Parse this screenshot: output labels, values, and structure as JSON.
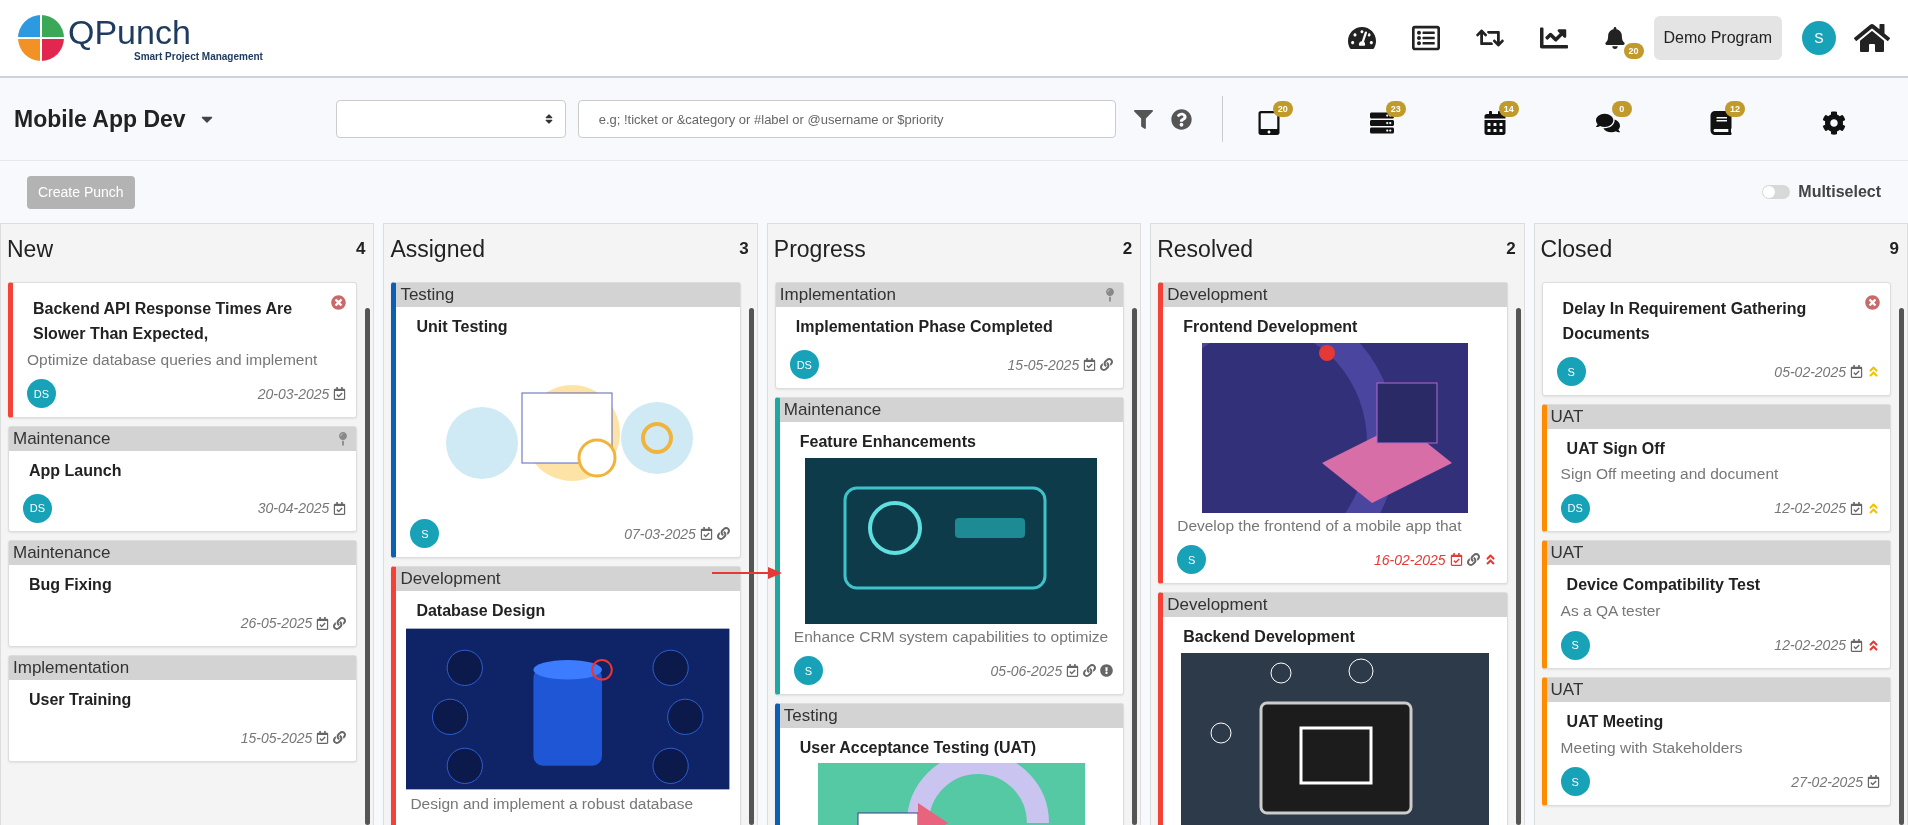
{
  "app": {
    "logo_title": "QPunch",
    "logo_subtitle": "Smart Project Management"
  },
  "header": {
    "notifications_badge": "20",
    "program_button": "Demo Program",
    "user_avatar": "S"
  },
  "toolbar": {
    "project": "Mobile App Dev",
    "search": {
      "placeholder": "e.g; !ticket or &category or #label or @username or $priority"
    },
    "counters": [
      {
        "kind": "tablet",
        "badge": "20"
      },
      {
        "kind": "list",
        "badge": "23"
      },
      {
        "kind": "calendar",
        "badge": "14"
      },
      {
        "kind": "comments",
        "badge": "0"
      },
      {
        "kind": "book",
        "badge": "12"
      },
      {
        "kind": "settings"
      }
    ]
  },
  "actions": {
    "create_button": "Create Punch",
    "create_disabled": true,
    "multiselect": {
      "label": "Multiselect",
      "on": false
    }
  },
  "columns": [
    {
      "title": "New",
      "count": "4",
      "cards": [
        {
          "color": "#f44336",
          "title": "Backend API Response Times Are Slower Than Expected,",
          "description": "Optimize database queries and implement",
          "avatar": "DS",
          "date": "20-03-2025",
          "cancelled": true
        },
        {
          "category": "Maintenance",
          "title": "App Launch",
          "avatar": "DS",
          "date": "30-04-2025",
          "pinned": true
        },
        {
          "category": "Maintenance",
          "title": "Bug Fixing",
          "date": "26-05-2025",
          "linked": true
        },
        {
          "category": "Implementation",
          "title": "User Training",
          "date": "15-05-2025",
          "linked": true
        }
      ]
    },
    {
      "title": "Assigned",
      "count": "3",
      "cards": [
        {
          "category": "Testing",
          "color": "#0d5fb3",
          "title": "Unit Testing",
          "image": {
            "kind": "testing"
          },
          "avatar": "S",
          "date": "07-03-2025",
          "linked": true
        },
        {
          "category": "Development",
          "color": "#f44336",
          "title": "Database Design",
          "image": {
            "kind": "database"
          },
          "description": "Design and implement a robust database"
        }
      ]
    },
    {
      "title": "Progress",
      "count": "2",
      "cards": [
        {
          "category": "Implementation",
          "title": "Implementation Phase Completed",
          "avatar": "DS",
          "date": "15-05-2025",
          "linked": true,
          "pinned": true
        },
        {
          "category": "Maintenance",
          "color": "#1fa8a0",
          "title": "Feature Enhancements",
          "image": {
            "kind": "update"
          },
          "description": "Enhance CRM system capabilities to optimize",
          "avatar": "S",
          "date": "05-06-2025",
          "linked": true,
          "alert": true
        },
        {
          "category": "Testing",
          "color": "#0d5fb3",
          "title": "User Acceptance Testing (UAT)",
          "image": {
            "kind": "uat"
          }
        }
      ]
    },
    {
      "title": "Resolved",
      "count": "2",
      "cards": [
        {
          "category": "Development",
          "color": "#f44336",
          "title": "Frontend Development",
          "image": {
            "kind": "frontend"
          },
          "description": "Develop the frontend of a mobile app that",
          "avatar": "S",
          "date": "16-02-2025",
          "overdue": true,
          "linked": true,
          "priority": {
            "color": "#e53935"
          }
        },
        {
          "category": "Development",
          "color": "#f44336",
          "title": "Backend Development",
          "image": {
            "kind": "backend"
          }
        }
      ]
    },
    {
      "title": "Closed",
      "count": "9",
      "cards": [
        {
          "title": "Delay In Requirement Gathering Documents",
          "avatar": "S",
          "date": "05-02-2025",
          "cancelled": true,
          "priority": {
            "color": "#f2c200"
          }
        },
        {
          "category": "UAT",
          "color": "#ff8c00",
          "title": "UAT Sign Off",
          "description": "Sign Off meeting and document",
          "avatar": "DS",
          "date": "12-02-2025",
          "priority": {
            "color": "#f2c200"
          }
        },
        {
          "category": "UAT",
          "color": "#ff8c00",
          "title": "Device Compatibility Test",
          "description": "As a QA tester",
          "avatar": "S",
          "date": "12-02-2025",
          "priority": {
            "color": "#e53935"
          }
        },
        {
          "category": "UAT",
          "color": "#ff8c00",
          "title": "UAT Meeting",
          "description": "Meeting with Stakeholders",
          "avatar": "S",
          "date": "27-02-2025"
        }
      ]
    }
  ]
}
